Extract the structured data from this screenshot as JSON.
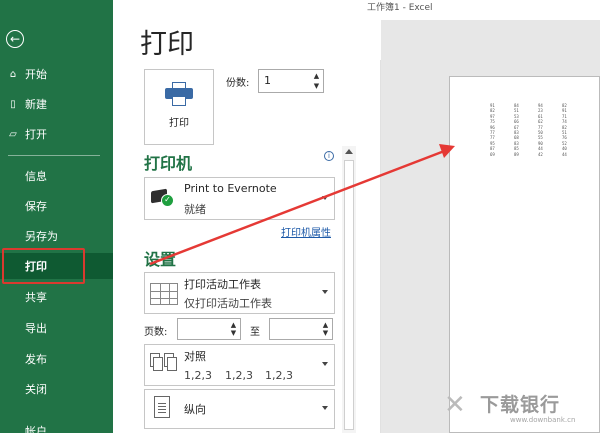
{
  "window": {
    "title": "工作簿1  -  Excel"
  },
  "sidebar": {
    "back_icon": "←",
    "top_items": [
      {
        "label": "开始",
        "icon": "home-icon"
      },
      {
        "label": "新建",
        "icon": "new-file-icon"
      },
      {
        "label": "打开",
        "icon": "folder-open-icon"
      }
    ],
    "items": [
      {
        "label": "信息"
      },
      {
        "label": "保存"
      },
      {
        "label": "另存为"
      },
      {
        "label": "打印"
      },
      {
        "label": "共享"
      },
      {
        "label": "导出"
      },
      {
        "label": "发布"
      },
      {
        "label": "关闭"
      },
      {
        "label": "帐户"
      }
    ],
    "active": "打印",
    "accent": "#217346",
    "highlight_color": "#d93a2f"
  },
  "main": {
    "title": "打印",
    "print_button_label": "打印",
    "copies_label": "份数:",
    "copies_value": "1",
    "printer_heading": "打印机",
    "printer_name": "Print to Evernote",
    "printer_status": "就绪",
    "printer_props_link": "打印机属性",
    "settings_heading": "设置",
    "scope_main": "打印活动工作表",
    "scope_sub": "仅打印活动工作表",
    "pages_label": "页数:",
    "pages_to_label": "至",
    "collate_main": "对照",
    "collate_sub": [
      "1,2,3",
      "1,2,3",
      "1,2,3"
    ],
    "orientation": "纵向"
  },
  "preview": {
    "rows": [
      [
        "91",
        "84",
        "94",
        "82"
      ],
      [
        "82",
        "51",
        "23",
        "91"
      ],
      [
        "97",
        "53",
        "61",
        "71"
      ],
      [
        "75",
        "66",
        "62",
        "74"
      ],
      [
        "96",
        "67",
        "77",
        "82"
      ],
      [
        "77",
        "83",
        "50",
        "51"
      ],
      [
        "77",
        "68",
        "55",
        "76"
      ],
      [
        "95",
        "83",
        "90",
        "52"
      ],
      [
        "87",
        "85",
        "44",
        "40"
      ],
      [
        "69",
        "89",
        "42",
        "44"
      ]
    ]
  },
  "watermark": {
    "text": "下载银行",
    "url": "www.downbank.cn"
  }
}
